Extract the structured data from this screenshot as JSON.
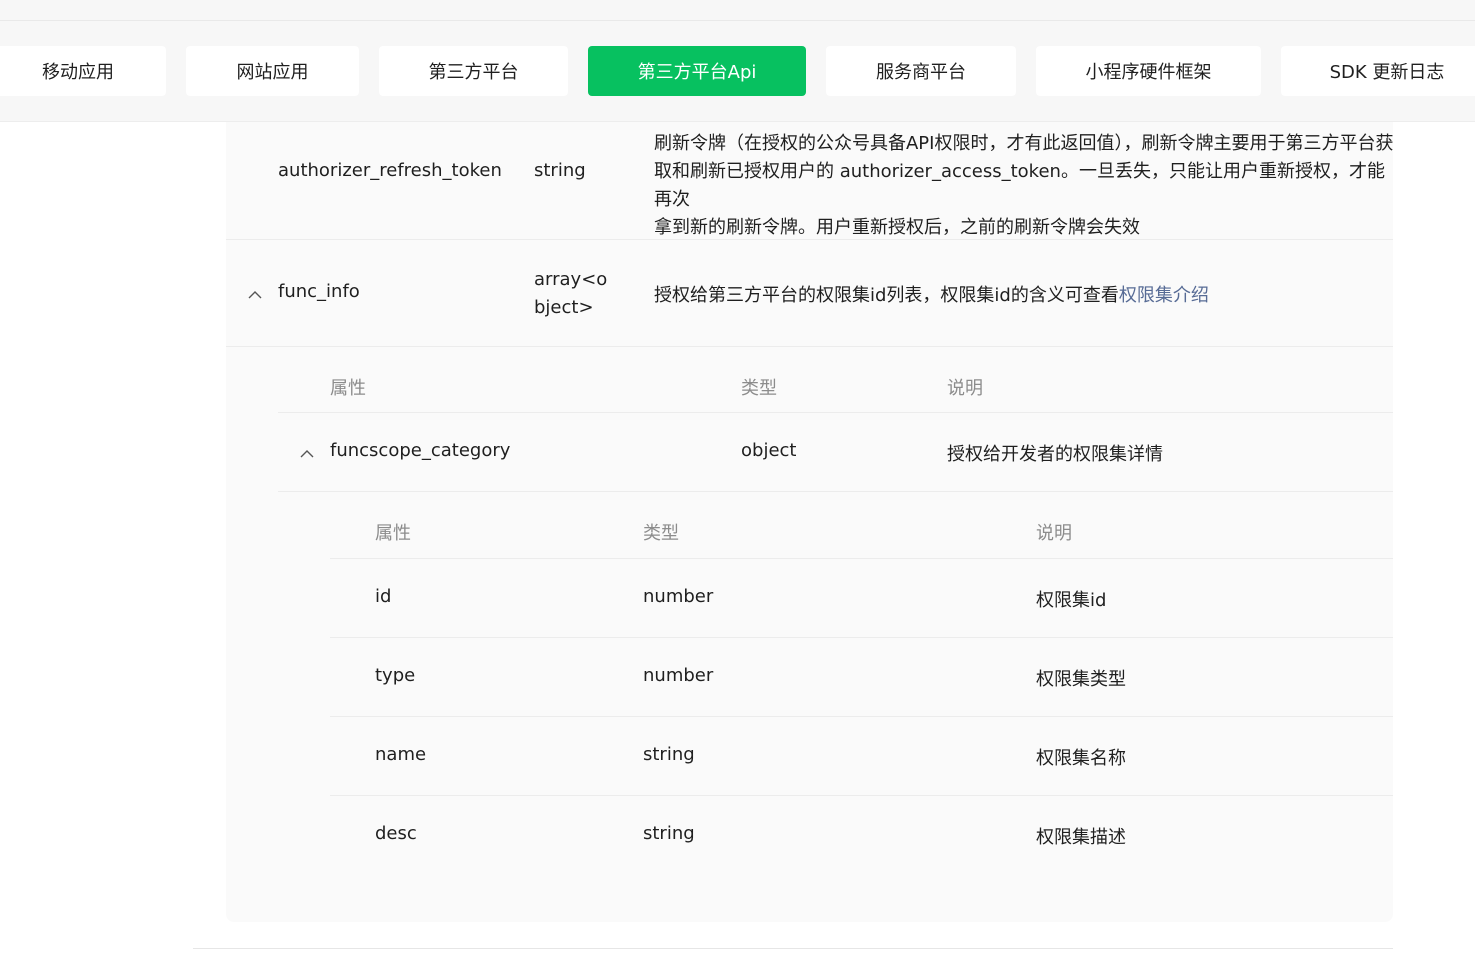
{
  "tabs": [
    {
      "label": "移动应用",
      "active": false
    },
    {
      "label": "网站应用",
      "active": false
    },
    {
      "label": "第三方平台",
      "active": false
    },
    {
      "label": "第三方平台Api",
      "active": true
    },
    {
      "label": "服务商平台",
      "active": false
    },
    {
      "label": "小程序硬件框架",
      "active": false
    },
    {
      "label": "SDK 更新日志",
      "active": false
    }
  ],
  "colors": {
    "accent": "#07c160",
    "link": "#576b95"
  },
  "rows": {
    "refresh_token": {
      "name": "authorizer_refresh_token",
      "type": "string",
      "desc_line1": "刷新令牌（在授权的公众号具备API权限时，才有此返回值），刷新令牌主要用于第三方平台获",
      "desc_line2": "取和刷新已授权用户的 authorizer_access_token。一旦丢失，只能让用户重新授权，才能再次",
      "desc_line3": "拿到新的刷新令牌。用户重新授权后，之前的刷新令牌会失效"
    },
    "func_info": {
      "name": "func_info",
      "type_line1": "array<o",
      "type_line2": "bject>",
      "desc": "授权给第三方平台的权限集id列表，权限集id的含义可查看",
      "desc_link": "权限集介绍"
    }
  },
  "nested1": {
    "headers": {
      "attr": "属性",
      "type": "类型",
      "desc": "说明"
    },
    "row": {
      "name": "funcscope_category",
      "type": "object",
      "desc": "授权给开发者的权限集详情"
    }
  },
  "nested2": {
    "headers": {
      "attr": "属性",
      "type": "类型",
      "desc": "说明"
    },
    "rows": [
      {
        "name": "id",
        "type": "number",
        "desc": "权限集id"
      },
      {
        "name": "type",
        "type": "number",
        "desc": "权限集类型"
      },
      {
        "name": "name",
        "type": "string",
        "desc": "权限集名称"
      },
      {
        "name": "desc",
        "type": "string",
        "desc": "权限集描述"
      }
    ]
  },
  "icons": {
    "collapse": "chevron-up-icon"
  }
}
